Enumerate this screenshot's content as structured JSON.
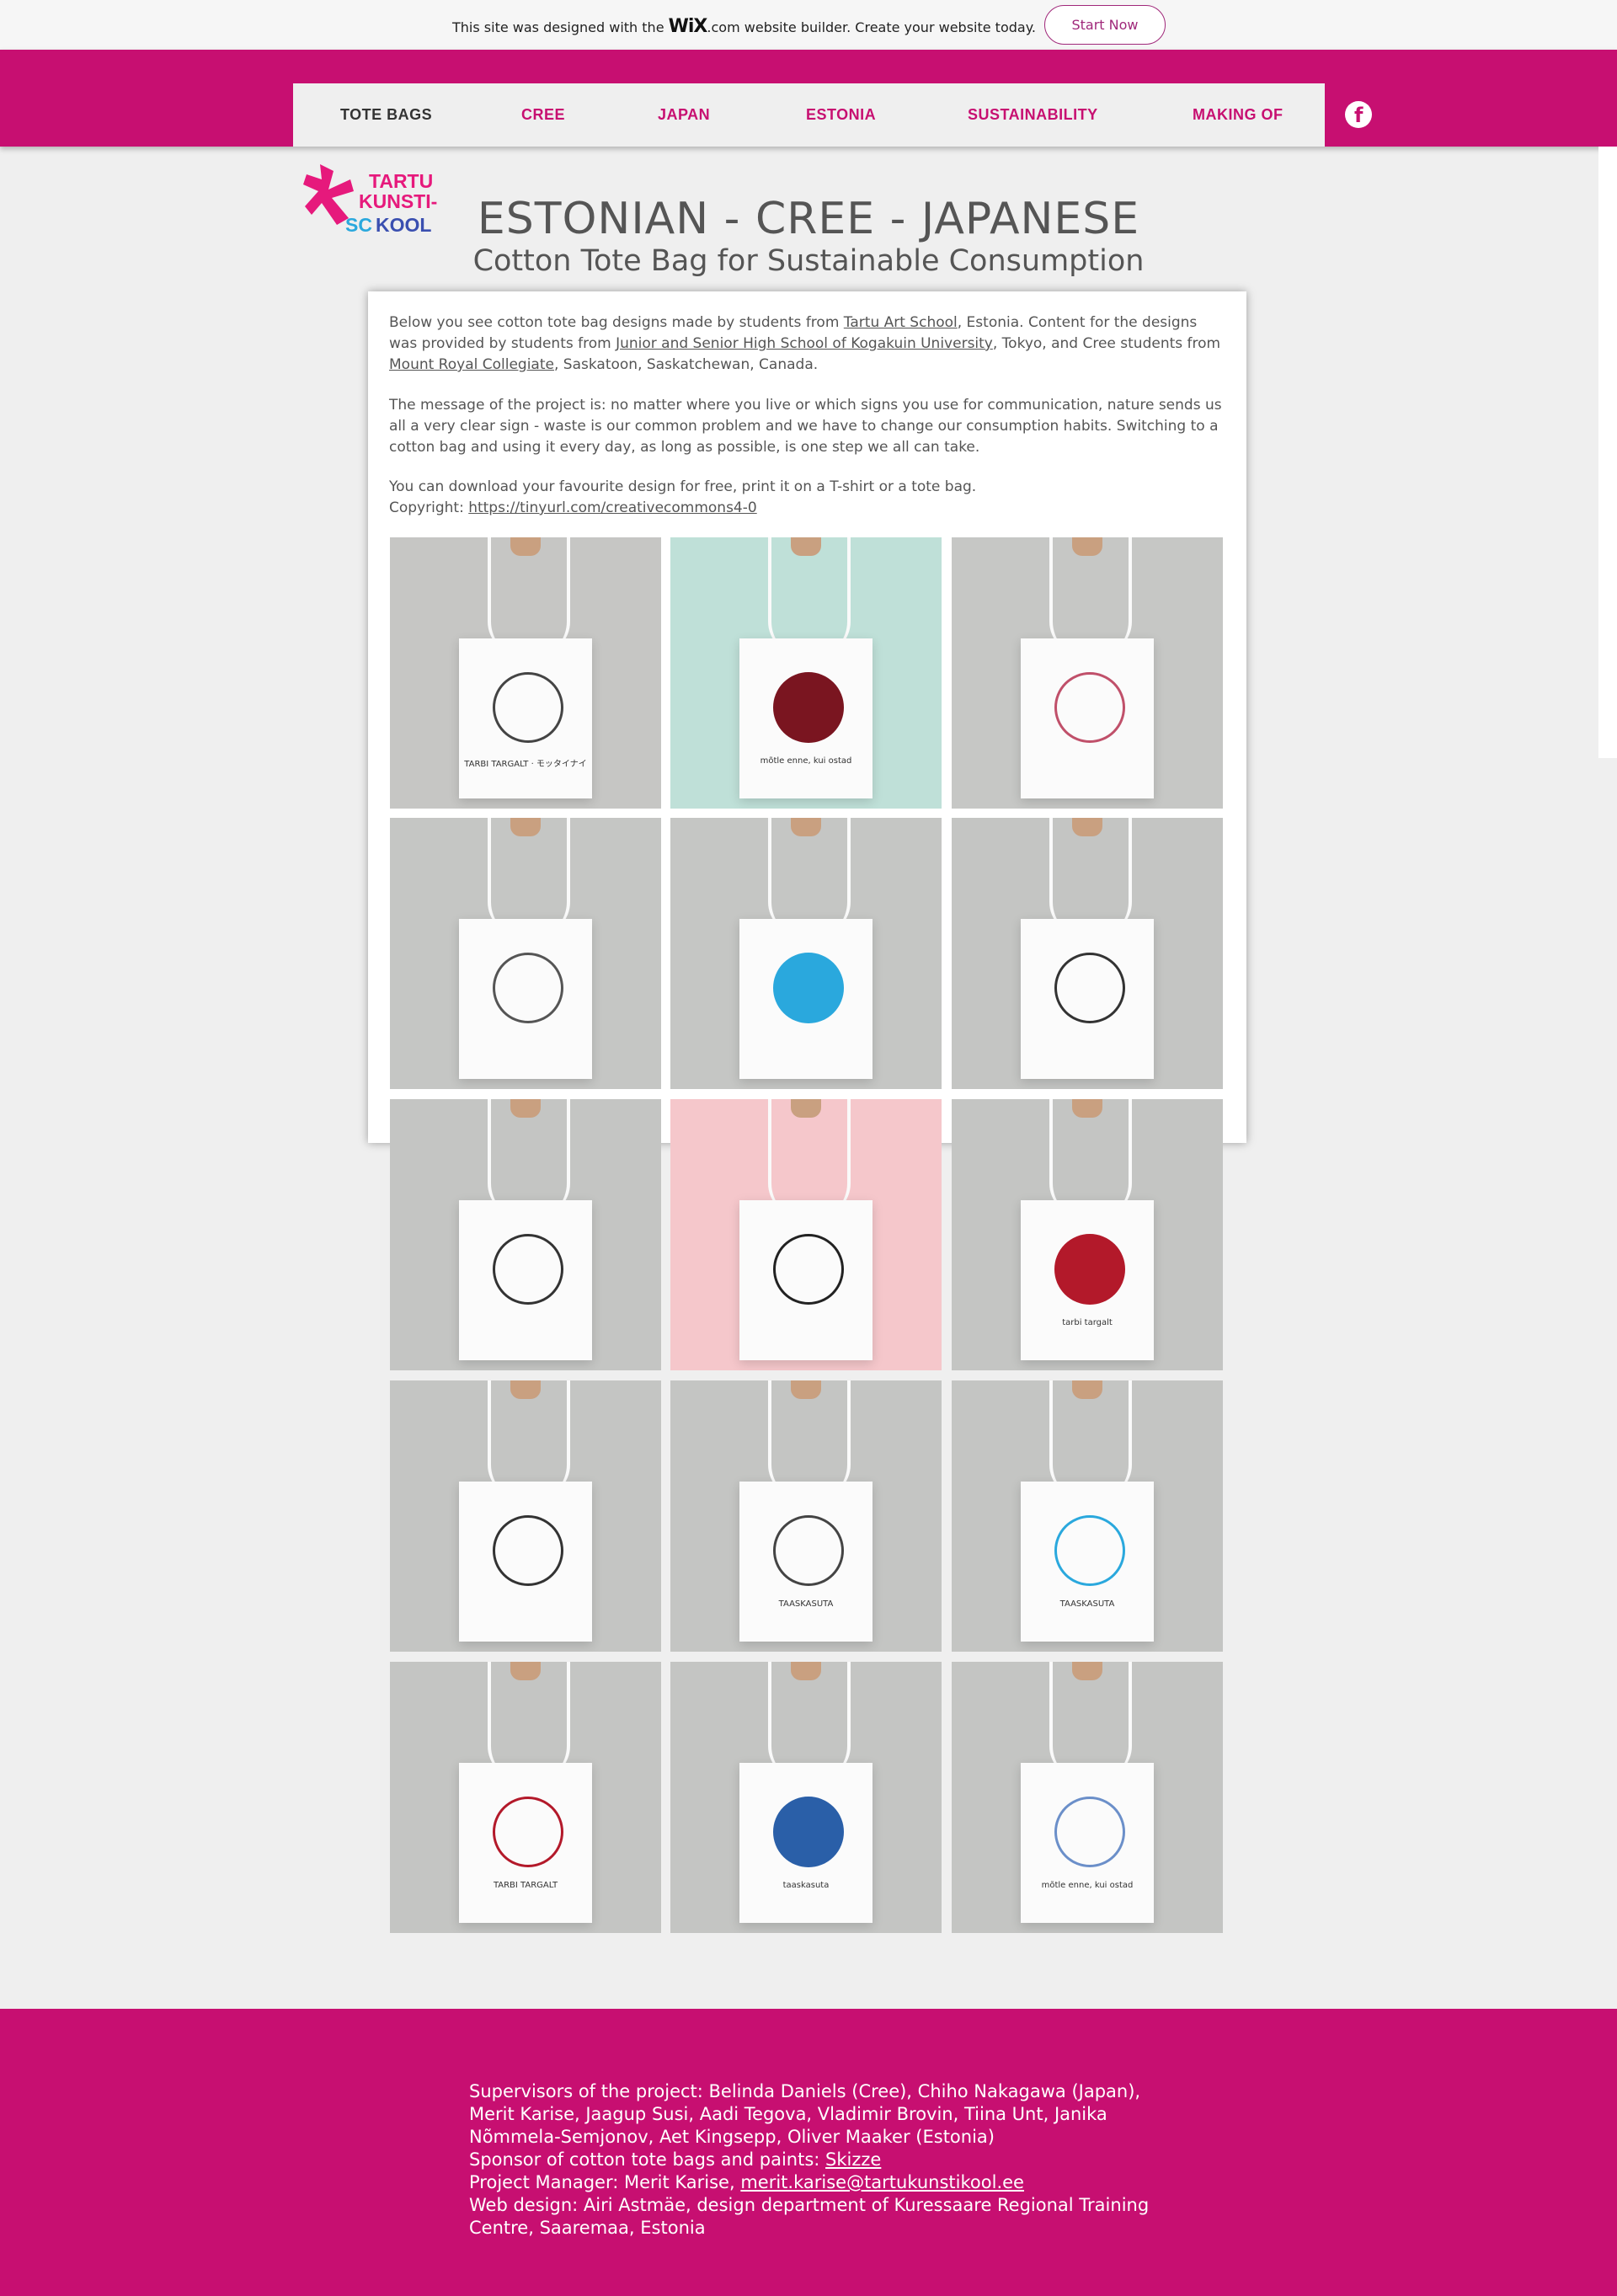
{
  "wix_banner": {
    "text_before": "This site was designed with the ",
    "brand": "WiX",
    "domain": ".com",
    "text_after": " website builder. Create your website today.",
    "cta": "Start Now"
  },
  "nav": {
    "items": [
      {
        "label": "TOTE BAGS",
        "active": true
      },
      {
        "label": "CREE"
      },
      {
        "label": "JAPAN"
      },
      {
        "label": "ESTONIA"
      },
      {
        "label": "SUSTAINABILITY"
      },
      {
        "label": "MAKING OF"
      }
    ],
    "social_icon": "facebook-icon"
  },
  "logo": {
    "line1": "TARTU",
    "line2": "KUNSTI-",
    "line3": "SCHOOL",
    "line3b": "KOOL"
  },
  "title": "ESTONIAN - CREE - JAPANESE",
  "subtitle": "Cotton Tote Bag for Sustainable Consumption",
  "intro": {
    "p1_a": "Below you see cotton tote bag designs made by students from ",
    "p1_link1": "Tartu Art School",
    "p1_b": ", Estonia. Content for the designs was provided by students from ",
    "p1_link2": "Junior and Senior High School of Kogakuin University",
    "p1_c": ", Tokyo, and Cree students from ",
    "p1_link3": "Mount Royal Collegiate",
    "p1_d": ", Saskatoon, Saskatchewan, Canada.",
    "p2": "The message of the project is: no matter where you live or which signs you use for communication, nature sends us all a very clear sign - waste is our common problem and we have to change our consumption habits. Switching to a cotton bag and using it every day, as long as possible, is one step we all can take.",
    "p3_a": "You can download your favourite design for free, print it on a T-shirt or a tote bag. Copyright: ",
    "p3_link": "https://tinyurl.com/creativecommons4-0"
  },
  "gallery": [
    {
      "bg": "#c6c6c4",
      "caption": "TARBI TARGALT · モッタイナイ"
    },
    {
      "bg": "#bfe0d8",
      "caption": "mõtle enne, kui ostad"
    },
    {
      "bg": "#c6c7c5",
      "caption": ""
    },
    {
      "bg": "#c5c6c4",
      "caption": ""
    },
    {
      "bg": "#c5c6c4",
      "caption": ""
    },
    {
      "bg": "#c4c5c3",
      "caption": ""
    },
    {
      "bg": "#c4c5c3",
      "caption": ""
    },
    {
      "bg": "#f5c7cb",
      "caption": ""
    },
    {
      "bg": "#c4c5c3",
      "caption": "tarbi targalt"
    },
    {
      "bg": "#c4c5c3",
      "caption": ""
    },
    {
      "bg": "#c4c5c3",
      "caption": "TAASKASUTA"
    },
    {
      "bg": "#c4c5c3",
      "caption": "TAASKASUTA"
    },
    {
      "bg": "#c4c5c3",
      "caption": "TARBI TARGALT"
    },
    {
      "bg": "#c4c5c3",
      "caption": "taaskasuta"
    },
    {
      "bg": "#c4c5c3",
      "caption": "mõtle enne, kui ostad"
    }
  ],
  "footer": {
    "line1": "Supervisors of the project: Belinda Daniels (Cree), Chiho Nakagawa (Japan), Merit Karise, Jaagup Susi, Aadi Tegova, Vladimir Brovin, Tiina Unt, Janika Nõmmela-Semjonov, Aet Kingsepp, Oliver Maaker (Estonia)",
    "sponsor_label": "Sponsor of cotton tote bags and paints: ",
    "sponsor_link": "Skizze",
    "pm_label": "Project Manager: Merit Karise, ",
    "pm_link": "merit.karise@tartukunstikool.ee",
    "webdesign": "Web design: Airi Astmäe, design department of Kuressaare Regional Training Centre, Saaremaa, Estonia"
  },
  "colors": {
    "brand": "#c70f71",
    "accent_blue": "#2aa8dd"
  }
}
